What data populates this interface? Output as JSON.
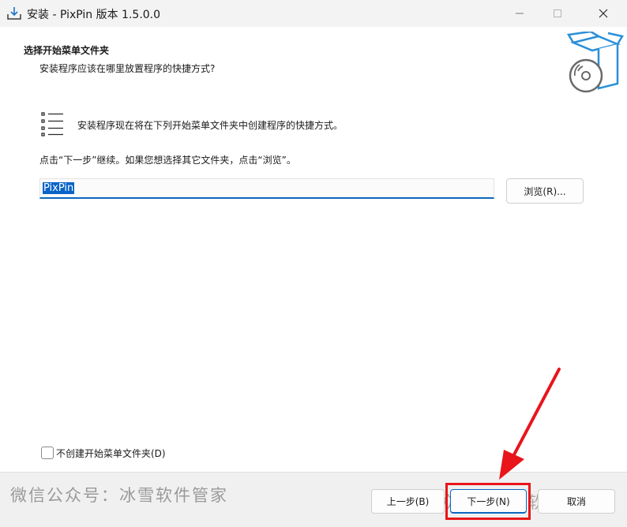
{
  "window": {
    "title": "安装 - PixPin 版本 1.5.0.0"
  },
  "header": {
    "heading": "选择开始菜单文件夹",
    "subheading": "安装程序应该在哪里放置程序的快捷方式?"
  },
  "main": {
    "info_text": "安装程序现在将在下列开始菜单文件夹中创建程序的快捷方式。",
    "hint_text": "点击“下一步”继续。如果您想选择其它文件夹，点击“浏览”。",
    "folder_value": "PixPin",
    "browse_label": "浏览(R)...",
    "no_folder_checkbox_label": "不创建开始菜单文件夹(D)",
    "no_folder_checked": false
  },
  "buttons": {
    "back": "上一步(B)",
    "next": "下一步(N)",
    "cancel": "取消"
  },
  "watermark": {
    "left": "微信公众号：冰雪软件管家",
    "right": "公众号 · 冰雪软件管家"
  },
  "colors": {
    "accent": "#0b67c0",
    "highlight": "#e8151b"
  }
}
